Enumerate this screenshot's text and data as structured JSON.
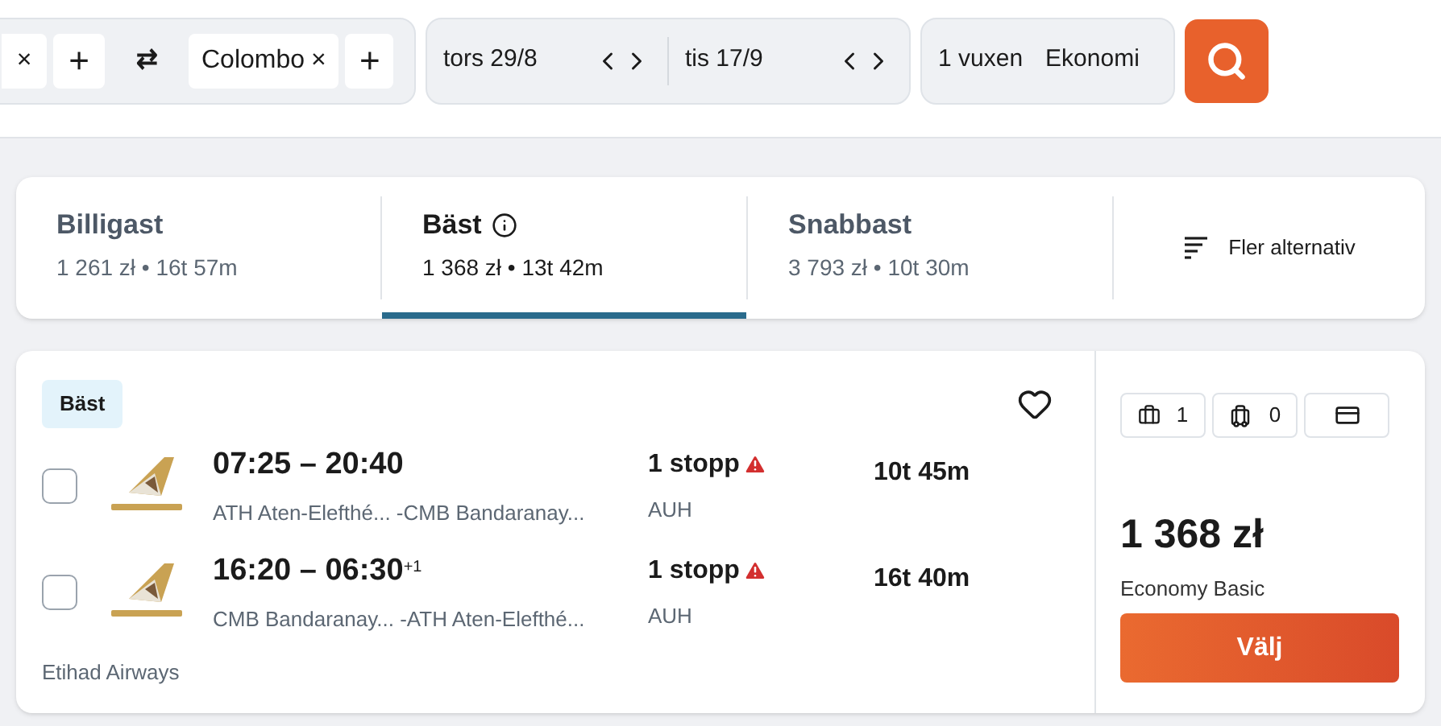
{
  "search_bar": {
    "origin_remove": "×",
    "origin_add": "+",
    "swap": "⇄",
    "destination": "Colombo",
    "destination_remove": "×",
    "destination_add": "+",
    "depart": "tors 29/8",
    "return": "tis 17/9",
    "passengers": "1 vuxen",
    "cabin": "Ekonomi"
  },
  "sort_tabs": [
    {
      "label": "Billigast",
      "detail": "1 261 zł • 16t 57m",
      "selected": false,
      "info": false
    },
    {
      "label": "Bäst",
      "detail": "1 368 zł • 13t 42m",
      "selected": true,
      "info": true
    },
    {
      "label": "Snabbast",
      "detail": "3 793 zł • 10t 30m",
      "selected": false,
      "info": false
    }
  ],
  "more_options": "Fler alternativ",
  "result": {
    "badge": "Bäst",
    "favorite": false,
    "legs": [
      {
        "checked": false,
        "times": "07:25 – 20:40",
        "route": "ATH Aten-Elefthé... -CMB Bandaranay...",
        "stops": "1 stopp",
        "warning": true,
        "via": "AUH",
        "duration": "10t 45m"
      },
      {
        "checked": false,
        "times": "16:20 – 06:30",
        "day_offset": "+1",
        "route": "CMB Bandaranay... -ATH Aten-Elefthé...",
        "stops": "1 stopp",
        "warning": true,
        "via": "AUH",
        "duration": "16t 40m"
      }
    ],
    "airline": "Etihad Airways",
    "bags": [
      {
        "kind": "personal",
        "count": "1"
      },
      {
        "kind": "cabin",
        "count": "0"
      },
      {
        "kind": "card"
      }
    ],
    "price": "1 368 zł",
    "fare": "Economy Basic",
    "select_button": "Välj"
  }
}
